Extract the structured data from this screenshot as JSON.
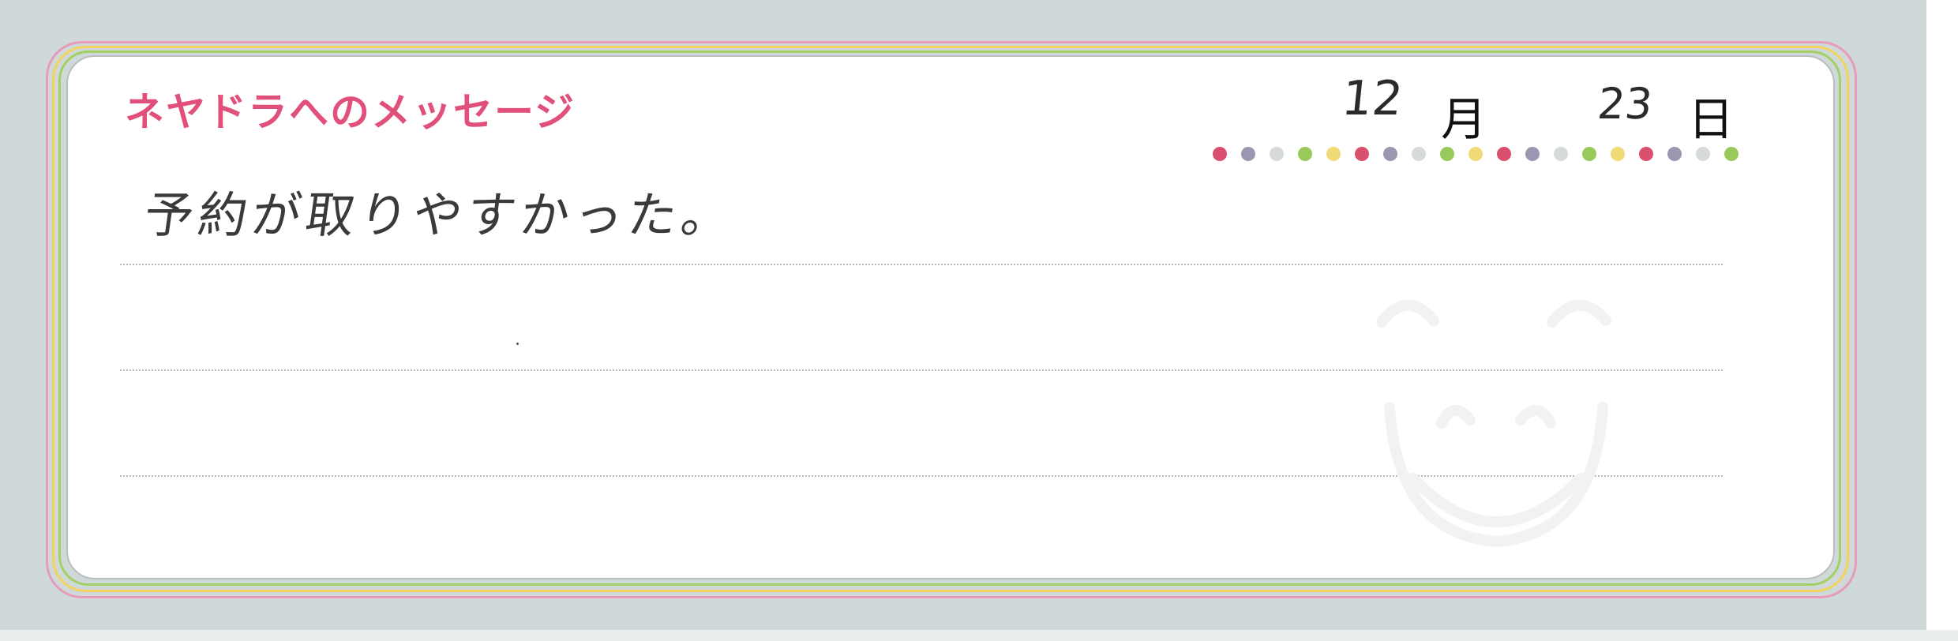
{
  "card": {
    "title": "ネヤドラへのメッセージ",
    "date": {
      "month": "12",
      "month_unit": "月",
      "day": "23",
      "day_unit": "日"
    },
    "message": "予約が取りやすかった。"
  },
  "colors": {
    "title": "#e0507a",
    "frame_pink": "#e79bb8",
    "frame_yellow": "#f2d35b",
    "frame_green": "#a4d063",
    "background": "#cfd9d9"
  },
  "dot_colors": [
    "#d9506e",
    "#9b97b0",
    "#d6dada",
    "#98c95a",
    "#f0db77",
    "#d9506e",
    "#9b97b0",
    "#d6dada",
    "#98c95a",
    "#f0db77",
    "#d9506e",
    "#9b97b0",
    "#d6dada",
    "#98c95a",
    "#f0db77",
    "#d9506e",
    "#9b97b0",
    "#d6dada",
    "#98c95a"
  ],
  "icons": {
    "watermark": "smiley-face-watermark-icon"
  }
}
